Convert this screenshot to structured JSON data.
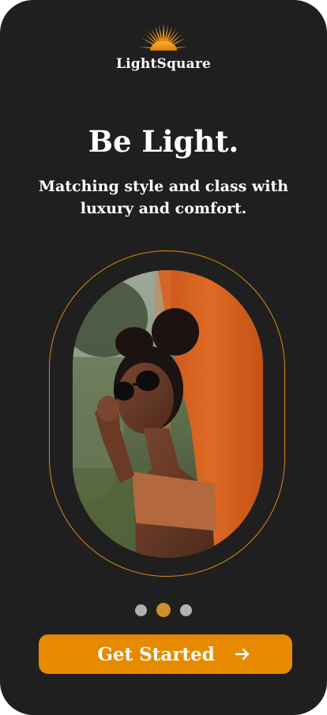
{
  "brand": {
    "name": "LightSquare",
    "logo_icon": "sunburst-icon",
    "accent_color": "#e68a00"
  },
  "hero": {
    "headline": "Be Light.",
    "subtitle": "Matching style and class with luxury and comfort."
  },
  "carousel": {
    "total": 3,
    "active_index": 1,
    "image": "woman-with-sunglasses-orange-wall"
  },
  "cta": {
    "label": "Get Started",
    "icon": "arrow-right-icon"
  }
}
